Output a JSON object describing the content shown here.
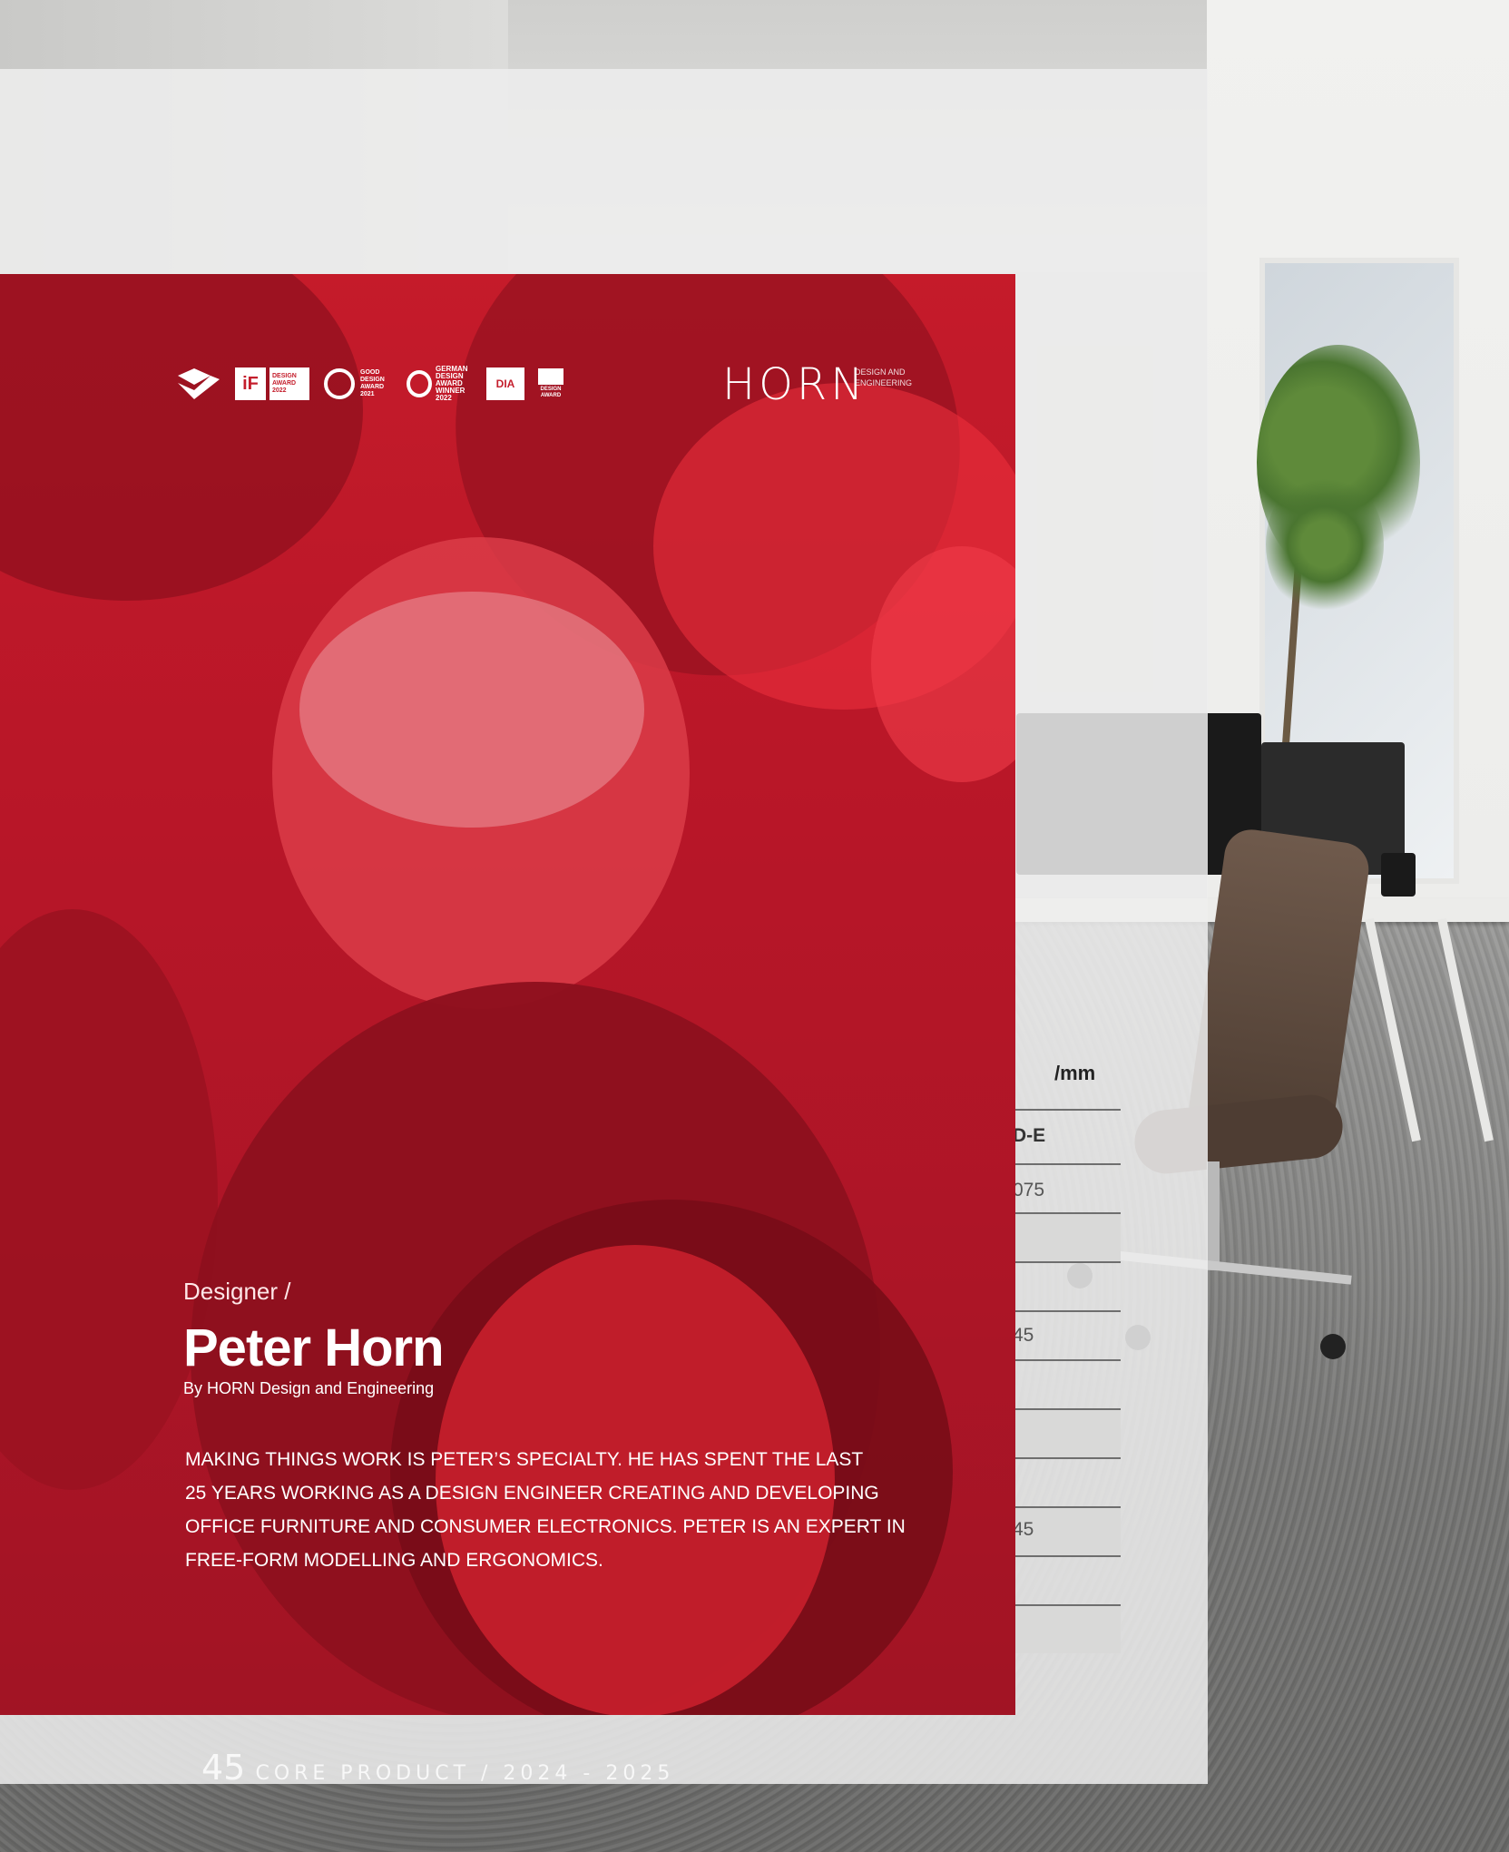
{
  "awards": {
    "logos": [
      "red-dot-award",
      "if-design-award-2022",
      "good-design-award-2021",
      "german-design-award-winner-2022",
      "dia-design-intelligence-award",
      "design-award"
    ],
    "if_mark": "iF",
    "if_text": "DESIGN AWARD 2022",
    "good_design_text": "GOOD DESIGN AWARD 2021",
    "german_design_text": "GERMAN DESIGN AWARD WINNER 2022",
    "dia_text": "DIA",
    "design_award_text": "DESIGN AWARD"
  },
  "brand": {
    "logo": "HORN",
    "sub": "DESIGN AND ENGINEERING"
  },
  "designer": {
    "label": "Designer /",
    "name": "Peter Horn",
    "by": "By HORN Design and Engineering",
    "bio_lines": [
      "MAKING THINGS WORK IS PETER’S SPECIALTY. HE HAS SPENT THE LAST",
      "25 YEARS WORKING AS A DESIGN ENGINEER CREATING AND DEVELOPING",
      "OFFICE FURNITURE AND CONSUMER ELECTRONICS. PETER IS AN EXPERT IN",
      "FREE-FORM MODELLING AND ERGONOMICS."
    ]
  },
  "spec_table": {
    "header": "/mm",
    "model": "D-E",
    "values": [
      "075",
      "45",
      "45"
    ]
  },
  "footer": {
    "page_number": "45",
    "text": "CORE PRODUCT / 2024 - 2025"
  }
}
